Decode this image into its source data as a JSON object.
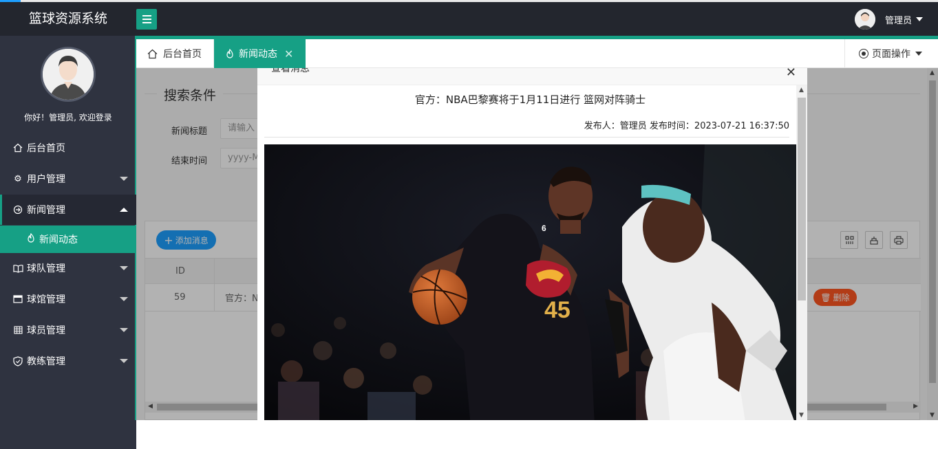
{
  "app": {
    "title": "篮球资源系统"
  },
  "header": {
    "user_name": "管理员"
  },
  "sidebar": {
    "welcome": "你好！管理员, 欢迎登录",
    "items": [
      {
        "label": "后台首页",
        "icon": "home-icon"
      },
      {
        "label": "用户管理",
        "icon": "gear-icon"
      },
      {
        "label": "新闻管理",
        "icon": "news-cycle-icon"
      },
      {
        "label": "新闻动态",
        "icon": "fire-icon"
      },
      {
        "label": "球队管理",
        "icon": "book-icon"
      },
      {
        "label": "球馆管理",
        "icon": "window-icon"
      },
      {
        "label": "球员管理",
        "icon": "table-icon"
      },
      {
        "label": "教练管理",
        "icon": "shield-icon"
      }
    ]
  },
  "tabs": {
    "home": "后台首页",
    "news": "新闻动态",
    "page_ops": "页面操作"
  },
  "search": {
    "legend": "搜索条件",
    "title_label": "新闻标题",
    "title_placeholder": "请输入",
    "end_label": "结束时间",
    "end_placeholder": "yyyy-M"
  },
  "table": {
    "add_label": "添加消息",
    "headers": [
      "ID"
    ],
    "rows": [
      {
        "id": "59",
        "title": "官方：N"
      }
    ],
    "delete_label": "删除"
  },
  "modal": {
    "title": "查看消息",
    "news_title": "官方：NBA巴黎赛将于1月11日进行 篮网对阵骑士",
    "meta": "发布人：管理员 发布时间：2023-07-21 16:37:50",
    "jersey_number": "45",
    "jersey_small": "6"
  },
  "colors": {
    "sidebar_bg": "#2f3340",
    "header_bg": "#23262e",
    "accent": "#16a085",
    "primary_btn": "#1e9fff",
    "danger_btn": "#ff5722"
  }
}
